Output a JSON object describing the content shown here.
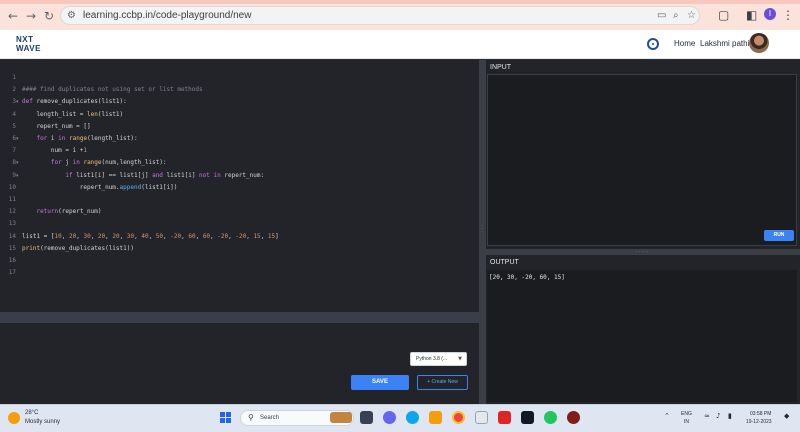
{
  "browser": {
    "url": "learning.ccbp.in/code-playground/new",
    "back_icon": "arrow-left",
    "forward_icon": "arrow-right",
    "reload_icon": "reload",
    "profile_initial": "I"
  },
  "header": {
    "logo_line1": "NXT",
    "logo_line2": "WAVE",
    "home_label": "Home",
    "user_name": "Lakshmi pathi"
  },
  "editor": {
    "line_numbers": [
      "1",
      "2",
      "3",
      "4",
      "5",
      "6",
      "7",
      "8",
      "9",
      "10",
      "11",
      "12",
      "13",
      "14",
      "15",
      "16",
      "17"
    ],
    "lines": [
      "",
      "#### find duplicates not using set or list methods",
      "def remove_duplicates(list1):",
      "    length_list = len(list1)",
      "    repert_num = []",
      "    for i in range(length_list):",
      "        num = i +1",
      "        for j in range(num,length_list):",
      "            if list1[i] == list1[j] and list1[i] not in repert_num:",
      "                repert_num.append(list1[i])",
      "",
      "    return(repert_num)",
      "",
      "list1 = [10, 20, 30, 20, 20, 30, 40, 50, -20, 60, 60, -20, -20, 15, 15]",
      "print(remove_duplicates(list1))",
      "",
      ""
    ]
  },
  "input_panel": {
    "title": "INPUT",
    "run_label": "RUN"
  },
  "output_panel": {
    "title": "OUTPUT",
    "text": "[20, 30, -20, 60, 15]"
  },
  "footer": {
    "language": "Python 3.8 (...",
    "save_label": "SAVE",
    "create_label": "+ Create New"
  },
  "taskbar": {
    "temperature": "28°C",
    "weather": "Mostly sunny",
    "search_placeholder": "Search",
    "lang_top": "ENG",
    "lang_bottom": "IN",
    "time": "03:58 PM",
    "date": "19-12-2023"
  }
}
